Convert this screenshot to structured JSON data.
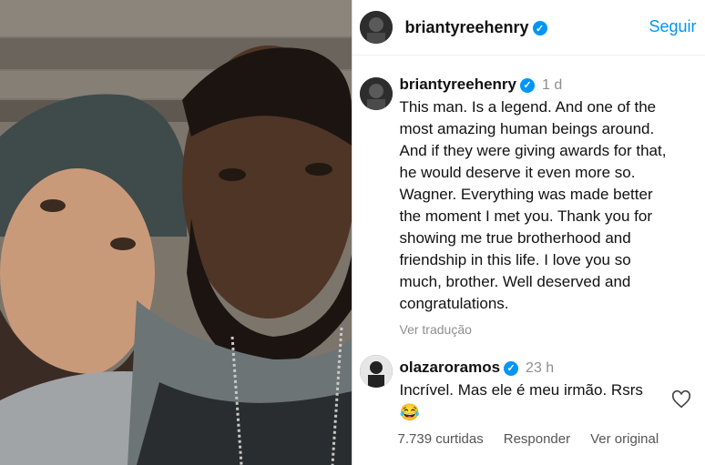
{
  "header": {
    "username": "briantyreehenry",
    "follow_label": "Seguir"
  },
  "post": {
    "username": "briantyreehenry",
    "time": "1 d",
    "caption_lines": [
      "This man. Is a legend. And one of  the",
      "most amazing  human beings around.",
      "And if they were giving awards for that,",
      "he would deserve it even more so.",
      "Wagner. Everything was made better",
      "the moment I met you. Thank you for",
      "showing me true brotherhood and",
      "friendship in this life. I love you so",
      "much, brother. Well deserved and",
      "congratulations."
    ],
    "translate_label": "Ver tradução"
  },
  "comment": {
    "username": "olazaroramos",
    "time": "23 h",
    "text": "Incrível. Mas ele é meu irmão. Rsrs",
    "emoji": "😂"
  },
  "actions": {
    "likes": "7.739 curtidas",
    "reply": "Responder",
    "original": "Ver original"
  },
  "colors": {
    "link": "#0095f6",
    "muted": "#8e8e8e",
    "verified": "#0095f6"
  },
  "icons": [
    "verified-badge-icon",
    "heart-icon"
  ]
}
